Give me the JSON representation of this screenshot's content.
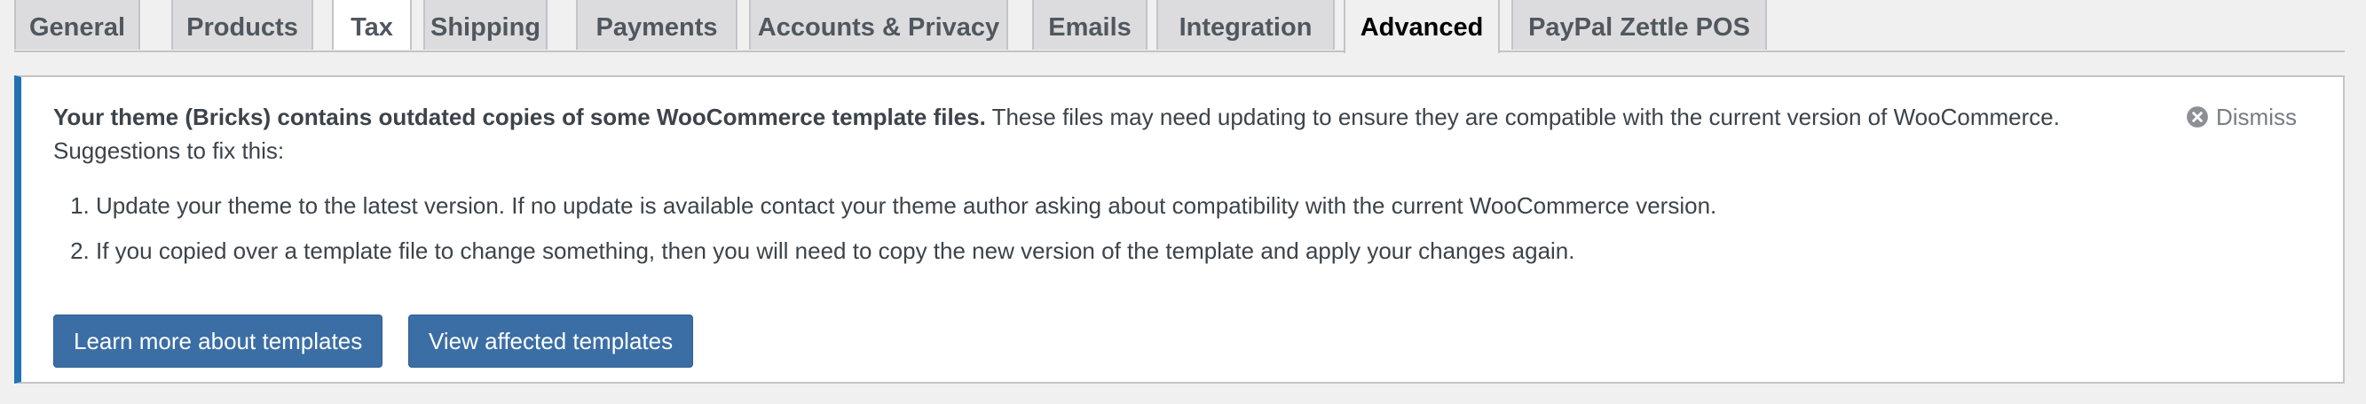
{
  "tabs": [
    {
      "label": "General"
    },
    {
      "label": "Products"
    },
    {
      "label": "Tax"
    },
    {
      "label": "Shipping"
    },
    {
      "label": "Payments"
    },
    {
      "label": "Accounts & Privacy"
    },
    {
      "label": "Emails"
    },
    {
      "label": "Integration"
    },
    {
      "label": "Advanced"
    },
    {
      "label": "PayPal Zettle POS"
    }
  ],
  "active_tab": "Advanced",
  "notice": {
    "headline": "Your theme (Bricks) contains outdated copies of some WooCommerce template files.",
    "body": " These files may need updating to ensure they are compatible with the current version of WooCommerce. Suggestions to fix this:",
    "dismiss_label": "Dismiss",
    "suggestions": [
      "Update your theme to the latest version. If no update is available contact your theme author asking about compatibility with the current WooCommerce version.",
      "If you copied over a template file to change something, then you will need to copy the new version of the template and apply your changes again."
    ],
    "buttons": {
      "learn_more": "Learn more about templates",
      "view_affected": "View affected templates"
    }
  },
  "colors": {
    "notice_accent": "#2271b1",
    "button_bg": "#3a6ea5",
    "page_bg": "#f0f0f1"
  },
  "icons": {
    "dismiss": "circle-x-icon"
  }
}
